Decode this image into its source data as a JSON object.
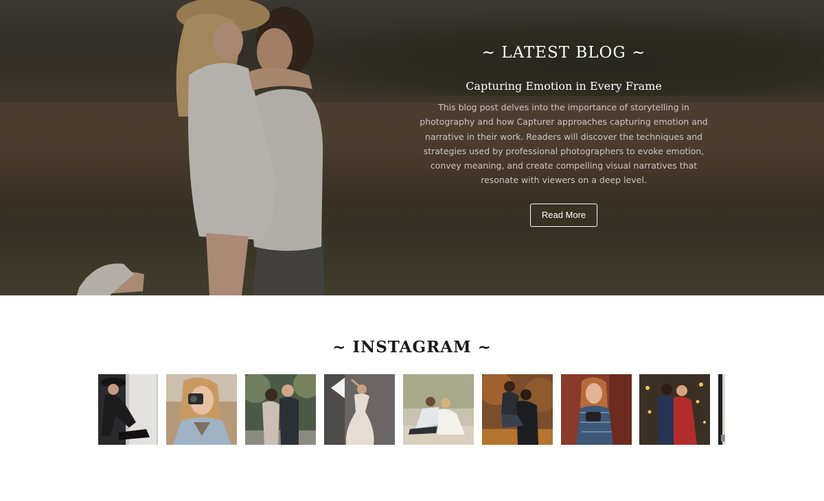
{
  "blog": {
    "section_title": "~ LATEST BLOG ~",
    "post_title": "Capturing Emotion in Every Frame",
    "excerpt": "This blog post delves into the importance of storytelling in photography and how Capturer approaches capturing emotion and narrative in their work. Readers will discover the techniques and strategies used by professional photographers to evoke emotion, convey meaning, and create compelling visual narratives that resonate with viewers on a deep level.",
    "read_more_label": "Read More"
  },
  "instagram": {
    "section_title": "~ INSTAGRAM ~",
    "tiles": [
      {
        "subject": "woman-in-black-hat-sitting",
        "bg": "#2a2a2c"
      },
      {
        "subject": "woman-with-camera-autumn",
        "bg": "#b49a78"
      },
      {
        "subject": "couple-in-forest",
        "bg": "#4b5a45"
      },
      {
        "subject": "woman-in-white-dress-dancing",
        "bg": "#6b6663"
      },
      {
        "subject": "couple-sitting-on-sand",
        "bg": "#c9c2b0"
      },
      {
        "subject": "couple-piggyback-autumn",
        "bg": "#7a4d2c"
      },
      {
        "subject": "woman-holding-camera-brick-wall",
        "bg": "#8a3a2a"
      },
      {
        "subject": "wedding-couple-lights",
        "bg": "#3b3024"
      },
      {
        "subject": "partial-photo",
        "bg": "#1f1f22"
      }
    ]
  },
  "colors": {
    "accent_white": "#ffffff",
    "excerpt_text": "#c9c6c1",
    "heading_dark": "#1b1b1b"
  }
}
